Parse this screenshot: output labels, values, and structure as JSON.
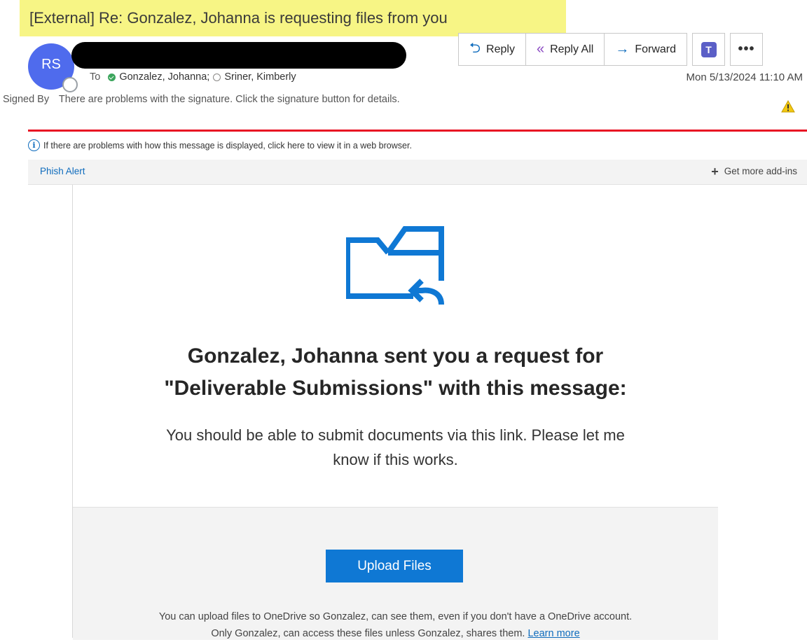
{
  "email": {
    "subject": "[External] Re: Gonzalez, Johanna is requesting files from you",
    "sender_initials": "RS",
    "to_label": "To",
    "recipients": [
      "Gonzalez, Johanna;",
      "Sriner, Kimberly"
    ],
    "datetime": "Mon 5/13/2024 11:10 AM",
    "signed_by_label": "Signed By",
    "signed_by_text": "There are problems with the signature. Click the signature button for details."
  },
  "toolbar": {
    "reply_label": "Reply",
    "reply_all_label": "Reply All",
    "forward_label": "Forward",
    "teams_icon": "teams-icon",
    "more_label": "•••"
  },
  "info_bar": {
    "text": "If there are problems with how this message is displayed, click here to view it in a web browser."
  },
  "addins": {
    "phish_alert_label": "Phish Alert",
    "get_more_label": "Get more add-ins"
  },
  "content": {
    "headline_line1": "Gonzalez, Johanna sent you a request for",
    "headline_line2": "\"Deliverable Submissions\" with this message:",
    "message_line1": "You should be able to submit documents via this link. Please let me",
    "message_line2": "know if this works.",
    "upload_button_label": "Upload Files",
    "footnote_line1": "You can upload files to OneDrive so Gonzalez, can see them, even if you don't have a OneDrive account.",
    "footnote_line2": "Only Gonzalez, can access these files unless Gonzalez, shares them.",
    "learn_more_label": "Learn more"
  },
  "colors": {
    "accent_blue": "#0f78d4",
    "subject_highlight": "#f7f585",
    "warning_rule": "#e81123",
    "avatar": "#4f6bed"
  }
}
